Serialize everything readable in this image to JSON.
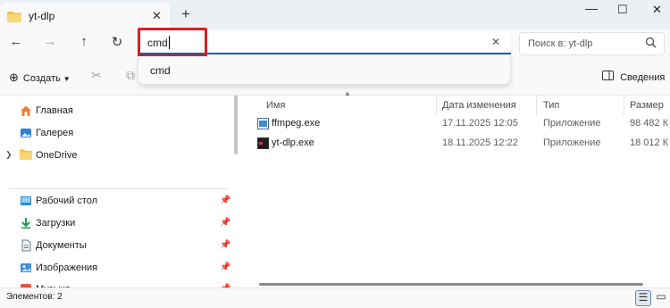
{
  "window": {
    "tab_title": "yt-dlp",
    "tab_close_icon": "close-icon",
    "new_tab_glyph": "+",
    "controls": [
      "minimize-icon",
      "maximize-icon",
      "close-icon"
    ]
  },
  "address": {
    "value": "cmd",
    "search_placeholder": "Поиск в: yt-dlp",
    "suggestion": "cmd"
  },
  "toolbar": {
    "create_label": "Создать",
    "details_label": "Сведения"
  },
  "sidebar": {
    "items": [
      {
        "label": "Главная",
        "icon": "home-icon",
        "pinned": false,
        "expandable": false
      },
      {
        "label": "Галерея",
        "icon": "gallery-icon",
        "pinned": false,
        "expandable": false
      },
      {
        "label": "OneDrive",
        "icon": "folder-icon",
        "pinned": false,
        "expandable": true
      },
      {
        "label": "Рабочий стол",
        "icon": "desktop-icon",
        "pinned": true,
        "expandable": false
      },
      {
        "label": "Загрузки",
        "icon": "download-icon",
        "pinned": true,
        "expandable": false
      },
      {
        "label": "Документы",
        "icon": "documents-icon",
        "pinned": true,
        "expandable": false
      },
      {
        "label": "Изображения",
        "icon": "pictures-icon",
        "pinned": true,
        "expandable": false
      },
      {
        "label": "Музыка",
        "icon": "music-icon",
        "pinned": true,
        "expandable": false
      }
    ]
  },
  "files": {
    "columns": [
      "Имя",
      "Дата изменения",
      "Тип",
      "Размер"
    ],
    "rows": [
      {
        "name": "ffmpeg.exe",
        "date": "17.11.2025 12:05",
        "type": "Приложение",
        "size": "98 482 К"
      },
      {
        "name": "yt-dlp.exe",
        "date": "18.11.2025 12:22",
        "type": "Приложение",
        "size": "18 012 К"
      }
    ]
  },
  "status": {
    "items_count": "Элементов: 2"
  },
  "colors": {
    "accent": "#005fb8",
    "highlight_box": "#d81f26",
    "folder": "#f3c14a"
  }
}
